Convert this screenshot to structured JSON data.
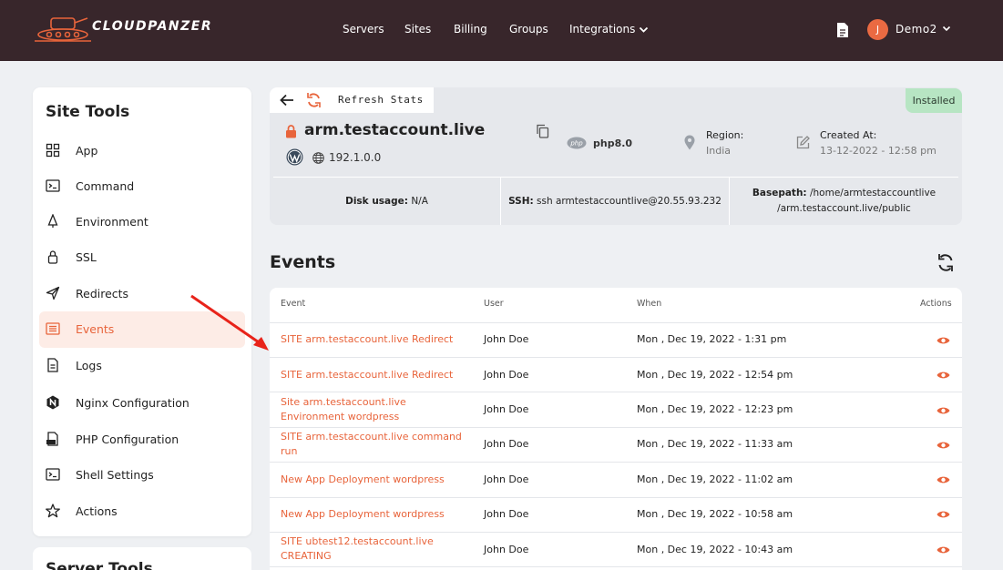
{
  "brand": {
    "name": "CLOUDPANZER"
  },
  "nav": {
    "items": [
      "Servers",
      "Sites",
      "Billing",
      "Groups",
      "Integrations"
    ]
  },
  "user": {
    "initial": "J",
    "name": "Demo2"
  },
  "sidebar": {
    "title": "Site Tools",
    "items": [
      {
        "label": "App",
        "icon": "grid-icon"
      },
      {
        "label": "Command",
        "icon": "terminal-icon"
      },
      {
        "label": "Environment",
        "icon": "tree-icon"
      },
      {
        "label": "SSL",
        "icon": "lock-icon"
      },
      {
        "label": "Redirects",
        "icon": "send-icon"
      },
      {
        "label": "Events",
        "icon": "list-icon",
        "active": true
      },
      {
        "label": "Logs",
        "icon": "file-icon"
      },
      {
        "label": "Nginx Configuration",
        "icon": "nginx-icon"
      },
      {
        "label": "PHP Configuration",
        "icon": "php-file-icon"
      },
      {
        "label": "Shell Settings",
        "icon": "terminal-icon"
      },
      {
        "label": "Actions",
        "icon": "star-icon"
      }
    ],
    "next_section_title": "Server Tools"
  },
  "site": {
    "refresh_label": "Refresh Stats",
    "status": "Installed",
    "name": "arm.testaccount.live",
    "ip": "192.1.0.0",
    "php": "php8.0",
    "region_label": "Region:",
    "region_value": "India",
    "created_label": "Created At:",
    "created_value": "13-12-2022 - 12:58 pm",
    "disk_label": "Disk usage:",
    "disk_value": "N/A",
    "ssh_label": "SSH:",
    "ssh_value": "ssh armtestaccountlive@20.55.93.232",
    "basepath_label": "Basepath:",
    "basepath_value_1": "/home/armtestaccountlive",
    "basepath_value_2": "/arm.testaccount.live/public"
  },
  "events": {
    "title": "Events",
    "columns": {
      "event": "Event",
      "user": "User",
      "when": "When",
      "actions": "Actions"
    },
    "rows": [
      {
        "event": "SITE arm.testaccount.live Redirect",
        "user": "John Doe",
        "when": "Mon , Dec 19, 2022 - 1:31 pm"
      },
      {
        "event": "SITE arm.testaccount.live Redirect",
        "user": "John Doe",
        "when": "Mon , Dec 19, 2022 - 12:54 pm"
      },
      {
        "event": "Site arm.testaccount.live Environment wordpress",
        "user": "John Doe",
        "when": "Mon , Dec 19, 2022 - 12:23 pm"
      },
      {
        "event": "SITE arm.testaccount.live command run",
        "user": "John Doe",
        "when": "Mon , Dec 19, 2022 - 11:33 am"
      },
      {
        "event": "New App Deployment wordpress",
        "user": "John Doe",
        "when": "Mon , Dec 19, 2022 - 11:02 am"
      },
      {
        "event": "New App Deployment wordpress",
        "user": "John Doe",
        "when": "Mon , Dec 19, 2022 - 10:58 am"
      },
      {
        "event": "SITE ubtest12.testaccount.live CREATING",
        "user": "John Doe",
        "when": "Mon , Dec 19, 2022 - 10:43 am"
      }
    ]
  },
  "colors": {
    "accent": "#e8643b",
    "topbar": "#38262b",
    "installed": "#b7e5c3"
  }
}
